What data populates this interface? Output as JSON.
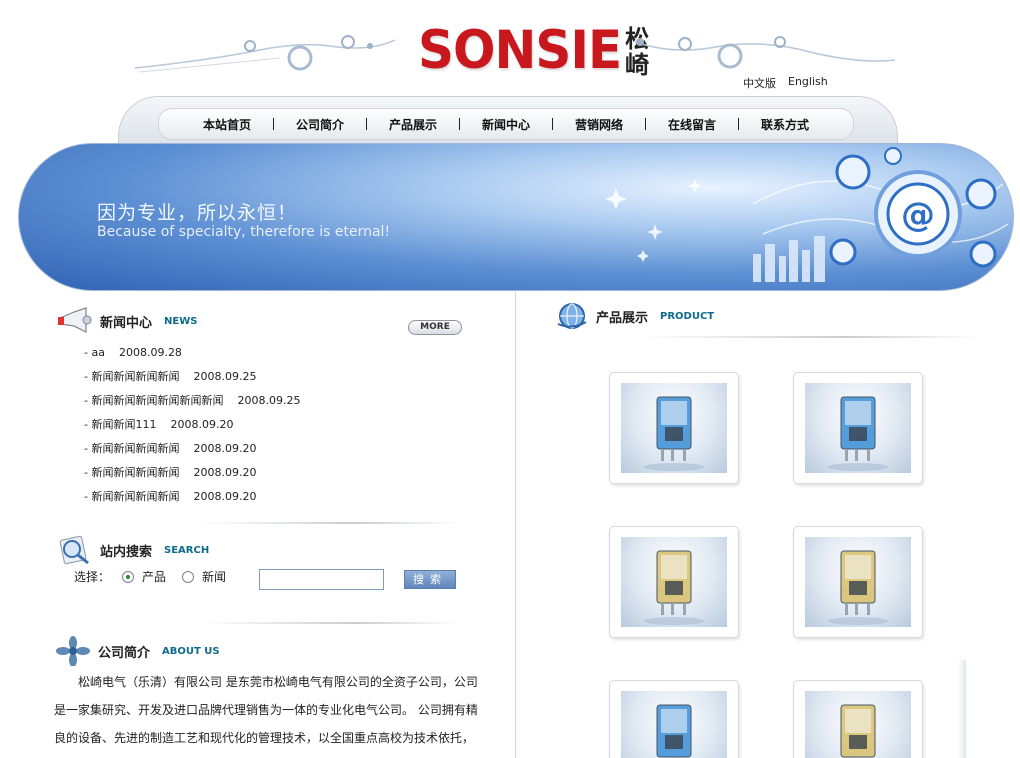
{
  "header": {
    "logo_text": "SONSIE",
    "logo_cn": "松崎",
    "lang_cn": "中文版",
    "lang_en": "English"
  },
  "nav": {
    "items": [
      "本站首页",
      "公司简介",
      "产品展示",
      "新闻中心",
      "营销网络",
      "在线留言",
      "联系方式"
    ]
  },
  "banner": {
    "slogan_cn": "因为专业，所以永恒！",
    "slogan_en": "Because of specialty, therefore is eternal!"
  },
  "news": {
    "title_cn": "新闻中心",
    "title_en": "NEWS",
    "more_label": "MORE",
    "items": [
      {
        "title": "- aa",
        "date": "2008.09.28"
      },
      {
        "title": "- 新闻新闻新闻新闻",
        "date": "2008.09.25"
      },
      {
        "title": "- 新闻新闻新闻新闻新闻新闻",
        "date": "2008.09.25"
      },
      {
        "title": "- 新闻新闻111",
        "date": "2008.09.20"
      },
      {
        "title": "- 新闻新闻新闻新闻",
        "date": "2008.09.20"
      },
      {
        "title": "- 新闻新闻新闻新闻",
        "date": "2008.09.20"
      },
      {
        "title": "- 新闻新闻新闻新闻",
        "date": "2008.09.20"
      }
    ]
  },
  "search": {
    "title_cn": "站内搜索",
    "title_en": "SEARCH",
    "select_label": "选择：",
    "option_product": "产品",
    "option_news": "新闻",
    "selected": "产品",
    "input_value": "",
    "button_label": "搜索"
  },
  "about": {
    "title_cn": "公司简介",
    "title_en": "ABOUT US",
    "text": "松崎电气（乐清）有限公司 是东莞市松崎电气有限公司的全资子公司，公司是一家集研究、开发及进口品牌代理销售为一体的专业化电气公司。    公司拥有精良的设备、先进的制造工艺和现代化的管理技术，以全国重点高校为技术依托，开发的新产品技术性能、质量可靠，广泛应用于电力、通讯、建筑、交通等领域"
  },
  "products": {
    "title_cn": "产品展示",
    "title_en": "PRODUCT",
    "items": [
      {
        "name": "product-relay-blue-1",
        "color": "#3a8fd6"
      },
      {
        "name": "product-relay-blue-2",
        "color": "#3a8fd6"
      },
      {
        "name": "product-relay-yellow-1",
        "color": "#d8c06a"
      },
      {
        "name": "product-relay-yellow-2",
        "color": "#d8c06a"
      },
      {
        "name": "product-relay-blue-3",
        "color": "#3a8fd6"
      },
      {
        "name": "product-relay-yellow-3",
        "color": "#d8c06a"
      }
    ]
  },
  "colors": {
    "brand_red": "#c8181e",
    "accent_teal": "#0e6b8c",
    "banner_blue": "#2f62b3"
  }
}
